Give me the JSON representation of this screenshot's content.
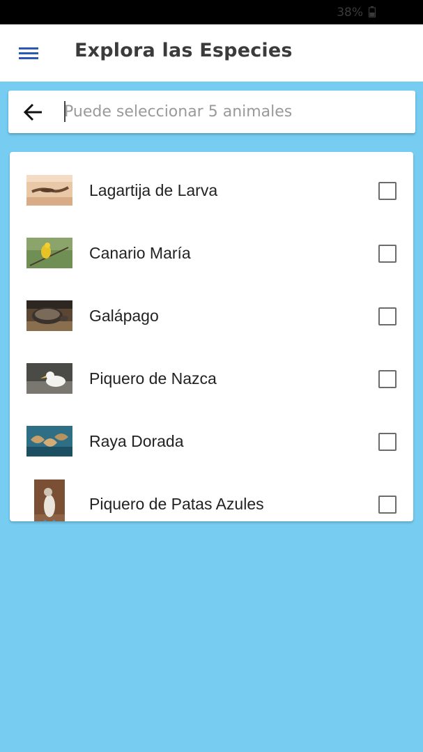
{
  "status_bar": {
    "battery_text": "38%",
    "battery_icon": "battery-icon"
  },
  "app_bar": {
    "title": "Explora las Especies",
    "menu_icon": "menu-icon",
    "accent_color": "#2b57b8"
  },
  "search": {
    "placeholder": "Puede seleccionar 5 animales",
    "value": "",
    "back_icon": "back-arrow-icon"
  },
  "species": [
    {
      "name": "Lagartija de Larva",
      "checked": false,
      "thumb": "lizard"
    },
    {
      "name": "Canario María",
      "checked": false,
      "thumb": "canary"
    },
    {
      "name": "Galápago",
      "checked": false,
      "thumb": "tortoise"
    },
    {
      "name": "Piquero de Nazca",
      "checked": false,
      "thumb": "nazca-booby"
    },
    {
      "name": "Raya Dorada",
      "checked": false,
      "thumb": "golden-ray"
    },
    {
      "name": "Piquero de Patas Azules",
      "checked": false,
      "thumb": "blue-footed-booby"
    }
  ],
  "colors": {
    "background": "#76ccf1",
    "card": "#ffffff",
    "checkbox_border": "#6b6b6b"
  }
}
